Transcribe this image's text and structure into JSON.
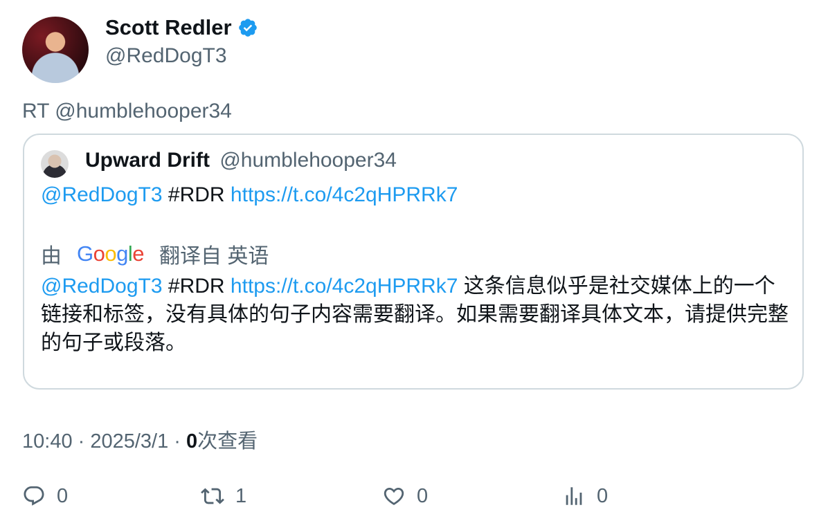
{
  "author": {
    "name": "Scott Redler",
    "handle": "@RedDogT3",
    "verified": true
  },
  "retweet_line": "RT @humblehooper34",
  "quoted": {
    "name": "Upward Drift",
    "handle": "@humblehooper34",
    "mention": "@RedDogT3",
    "hashtag": "#RDR",
    "link": "https://t.co/4c2qHPRRk7"
  },
  "translation": {
    "by_label": "由",
    "provider": "Google",
    "from_label": "翻译自 英语",
    "mention": "@RedDogT3",
    "hashtag": "#RDR",
    "link": "https://t.co/4c2qHPRRk7",
    "text": " 这条信息似乎是社交媒体上的一个链接和标签，没有具体的句子内容需要翻译。如果需要翻译具体文本，请提供完整的句子或段落。"
  },
  "meta": {
    "time_date": "10:40 · 2025/3/1 · ",
    "views_count": "0",
    "views_label": "次查看"
  },
  "actions": {
    "replies": "0",
    "retweets": "1",
    "likes": "0",
    "views": "0"
  },
  "colors": {
    "accent": "#1d9bf0",
    "secondary_text": "#536471",
    "border": "#cfd9de"
  }
}
